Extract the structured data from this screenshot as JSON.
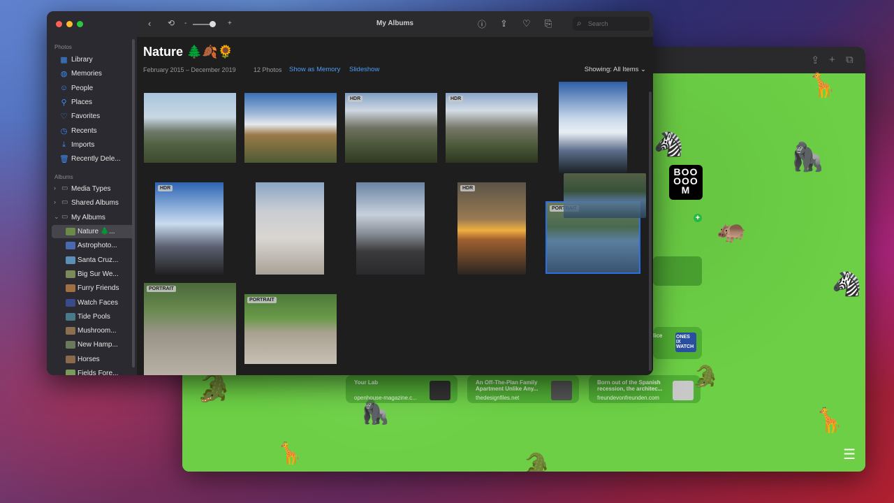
{
  "desktop": {
    "safari": {
      "cards": [
        {
          "title": "Your Lab",
          "site": "openhouse-magazine.c..."
        },
        {
          "title": "An Off-The-Plan Family Apartment Unlike Any...",
          "site": "thedesignfiles.net"
        },
        {
          "title": "Born out of the Spanish recession, the architec...",
          "site": "freundevonfreunden.com"
        }
      ],
      "tile_text": "BOO\nOOO\nM",
      "small_card_label": "lice",
      "watch_tile": "ONES IX WATCH"
    }
  },
  "photos": {
    "title": "My Albums",
    "search_placeholder": "Search",
    "sidebar": {
      "section_photos": "Photos",
      "items": [
        {
          "label": "Library",
          "icon": "library-icon"
        },
        {
          "label": "Memories",
          "icon": "memories-icon"
        },
        {
          "label": "People",
          "icon": "people-icon"
        },
        {
          "label": "Places",
          "icon": "places-icon"
        },
        {
          "label": "Favorites",
          "icon": "heart-icon"
        },
        {
          "label": "Recents",
          "icon": "clock-icon"
        },
        {
          "label": "Imports",
          "icon": "import-icon"
        },
        {
          "label": "Recently Dele...",
          "icon": "trash-icon"
        }
      ],
      "section_albums": "Albums",
      "groups": [
        {
          "label": "Media Types"
        },
        {
          "label": "Shared Albums"
        },
        {
          "label": "My Albums"
        }
      ],
      "albums": [
        {
          "label": "Nature 🌲...",
          "selected": true,
          "color": "#6b8a4a"
        },
        {
          "label": "Astrophoto...",
          "color": "#4a6ab0"
        },
        {
          "label": "Santa Cruz...",
          "color": "#5b8fb8"
        },
        {
          "label": "Big Sur We...",
          "color": "#7a8a5a"
        },
        {
          "label": "Furry Friends",
          "color": "#a07040"
        },
        {
          "label": "Watch Faces",
          "color": "#3a4a8a"
        },
        {
          "label": "Tide Pools",
          "color": "#4a7a8a"
        },
        {
          "label": "Mushroom...",
          "color": "#8a7050"
        },
        {
          "label": "New Hamp...",
          "color": "#6a7a5a"
        },
        {
          "label": "Horses",
          "color": "#8a6a4a"
        },
        {
          "label": "Fields Fore...",
          "color": "#7a9a5a"
        }
      ]
    },
    "album": {
      "title": "Nature 🌲🍂🌻",
      "date_range": "February 2015 – December 2019",
      "count": "12 Photos",
      "show_as_memory": "Show as Memory",
      "slideshow": "Slideshow",
      "showing": "Showing: All Items ⌄"
    },
    "photos": [
      {
        "badge": "",
        "bg": "linear-gradient(180deg,#a8c4dc 0%,#c9d8e4 35%,#6f7a6a 55%,#4f6040 75%,#3d4a2e 100%)"
      },
      {
        "badge": "",
        "bg": "linear-gradient(180deg,#3b6fb6 0%,#9fb9d8 30%,#e6e9ee 45%,#9b7a48 60%,#4d5a34 100%)"
      },
      {
        "badge": "HDR",
        "bg": "linear-gradient(180deg,#7f9fc4 0%,#cfd7e2 25%,#6f7262 50%,#4a5638 75%,#2f3a22 100%)"
      },
      {
        "badge": "HDR",
        "bg": "linear-gradient(180deg,#8aa6c8 0%,#d5dde6 25%,#77786a 50%,#4c5a3a 75%,#2c361f 100%)"
      },
      {
        "badge": "",
        "bg": "linear-gradient(180deg,#2e5fa6 0%,#c8d8ea 40%,#e9eef4 55%,#5a6d8a 75%,#1a1f22 100%)"
      },
      {
        "badge": "HDR",
        "bg": "linear-gradient(180deg,#2d64b4 0%,#c9dcf0 45%,#5a6070 70%,#222 100%)"
      },
      {
        "badge": "",
        "bg": "linear-gradient(180deg,#8aa6c4 0%,#c8ccd2 30%,#d9d6d2 60%,#a8a298 100%)"
      },
      {
        "badge": "",
        "bg": "linear-gradient(180deg,#6a84a4 0%,#c6d0dc 35%,#8a9098 55%,#3a3a3c 75%,#2a2a2c 100%)"
      },
      {
        "badge": "HDR",
        "bg": "linear-gradient(180deg,#5a5448 0%,#9a7a52 40%,#f0b040 52%,#a06030 62%,#2a2620 100%)"
      },
      {
        "badge": "PORTRAIT",
        "bg": "linear-gradient(180deg,#6a7a5a 0%,#4a6a50 35%,#5b7fa0 55%,#385470 100%)",
        "selected": true
      },
      {
        "badge": "PORTRAIT",
        "bg": "linear-gradient(180deg,#4a6a3a 0%,#6a8a50 30%,#9a9488 55%,#b8b0a4 100%)"
      },
      {
        "badge": "PORTRAIT",
        "bg": "linear-gradient(180deg,#4d7a3a 0%,#6a9a4a 35%,#a8a090 55%,#c8c0b4 100%)"
      }
    ]
  }
}
